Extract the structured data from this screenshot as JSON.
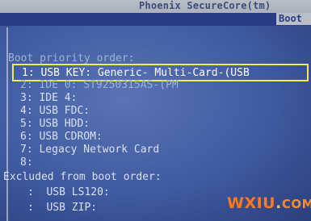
{
  "header": {
    "vendor_title": "Phoenix SecureCore(tm)",
    "active_tab": "Boot"
  },
  "boot_priority": {
    "heading": "Boot priority order:",
    "items": [
      {
        "index": "1:",
        "label": "USB KEY: Generic- Multi-Card-(USB"
      },
      {
        "index": "2:",
        "label": "IDE 0: ST9250315AS-(PM"
      },
      {
        "index": "3:",
        "label": "IDE 4:"
      },
      {
        "index": "4:",
        "label": "USB FDC:"
      },
      {
        "index": "5:",
        "label": "USB HDD:"
      },
      {
        "index": "6:",
        "label": "USB CDROM:"
      },
      {
        "index": "7:",
        "label": "Legacy Network Card"
      },
      {
        "index": "8:",
        "label": ""
      }
    ],
    "selected_index": 0
  },
  "excluded": {
    "heading": "Excluded from boot order:",
    "items": [
      {
        "index": ":",
        "label": "USB LS120:"
      },
      {
        "index": ":",
        "label": "USB ZIP:"
      }
    ]
  },
  "watermark": {
    "brand": "WXIU",
    "dot": ".",
    "tld": "COM"
  },
  "colors": {
    "background": "#4a64aa",
    "highlight_border": "#f0ef45",
    "header_bar": "#b9bdc6",
    "watermark": "#ff7a18"
  }
}
